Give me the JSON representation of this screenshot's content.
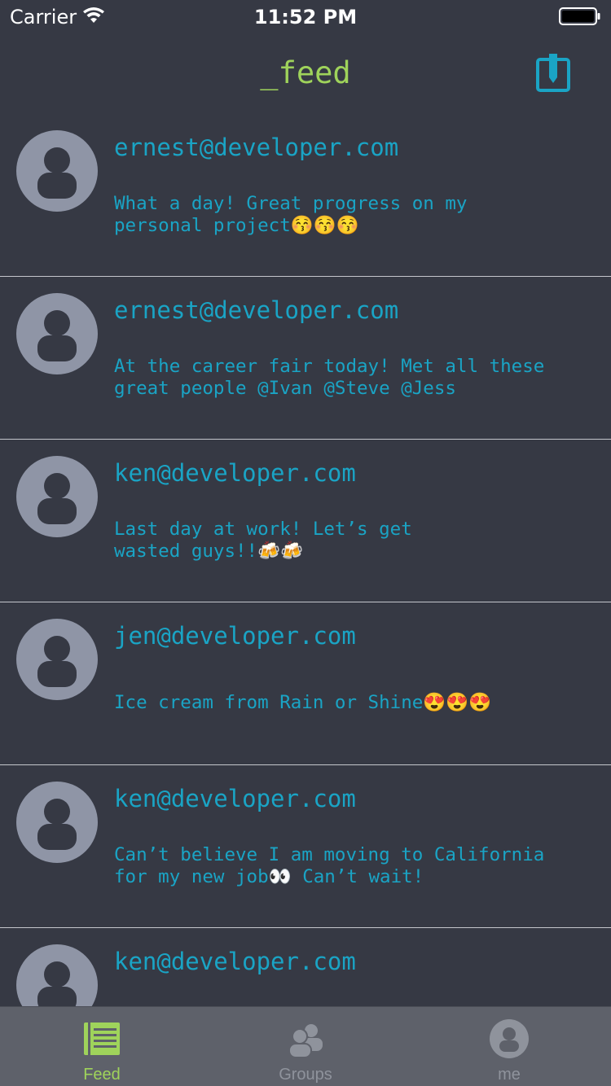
{
  "status_bar": {
    "carrier": "Carrier",
    "time": "11:52 PM"
  },
  "nav": {
    "title": "_feed",
    "title_color": "#9fd35b",
    "compose_icon": "compose-icon"
  },
  "colors": {
    "background": "#363944",
    "text_accent": "#1aa4c5",
    "active_tab": "#9fd35b",
    "inactive_tab": "#8f939c",
    "avatar": "#8f95a6"
  },
  "feed": [
    {
      "email": "ernest@developer.com",
      "text": "What a day! Great progress on my\npersonal project😚😚😚"
    },
    {
      "email": "ernest@developer.com",
      "text": "At the career fair today! Met all these\ngreat people @Ivan @Steve @Jess"
    },
    {
      "email": "ken@developer.com",
      "text": "Last day at work! Let’s get\nwasted guys!!🍻🍻"
    },
    {
      "email": "jen@developer.com",
      "text": "Ice cream from Rain or Shine😍😍😍"
    },
    {
      "email": "ken@developer.com",
      "text": "Can’t believe I am moving to California\nfor my new job👀 Can’t wait!"
    },
    {
      "email": "ken@developer.com",
      "text": ""
    }
  ],
  "tabs": [
    {
      "label": "Feed",
      "icon": "feed-icon",
      "active": true
    },
    {
      "label": "Groups",
      "icon": "groups-icon",
      "active": false
    },
    {
      "label": "me",
      "icon": "profile-icon",
      "active": false
    }
  ]
}
